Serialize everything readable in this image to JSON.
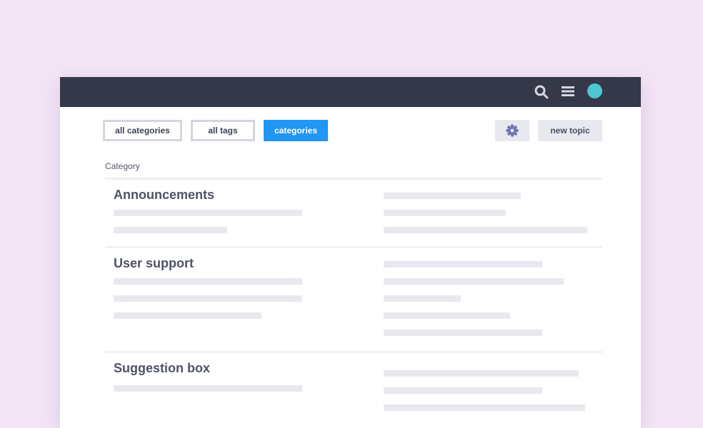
{
  "colors": {
    "page_bg": "#f3e5f6",
    "topbar_bg": "#343849",
    "accent": "#2196f3",
    "avatar": "#4cc7d2",
    "placeholder": "#e8e9ef"
  },
  "topbar": {
    "icons": [
      "search-icon",
      "menu-icon"
    ],
    "avatar": "avatar"
  },
  "filters": {
    "all_categories": "all categories",
    "all_tags": "all tags",
    "categories": "categories"
  },
  "actions": {
    "settings_icon": "gear-icon",
    "new_topic": "new topic"
  },
  "table": {
    "column_header": "Category",
    "categories": [
      {
        "title": "Announcements"
      },
      {
        "title": "User support"
      },
      {
        "title": "Suggestion box"
      }
    ]
  }
}
